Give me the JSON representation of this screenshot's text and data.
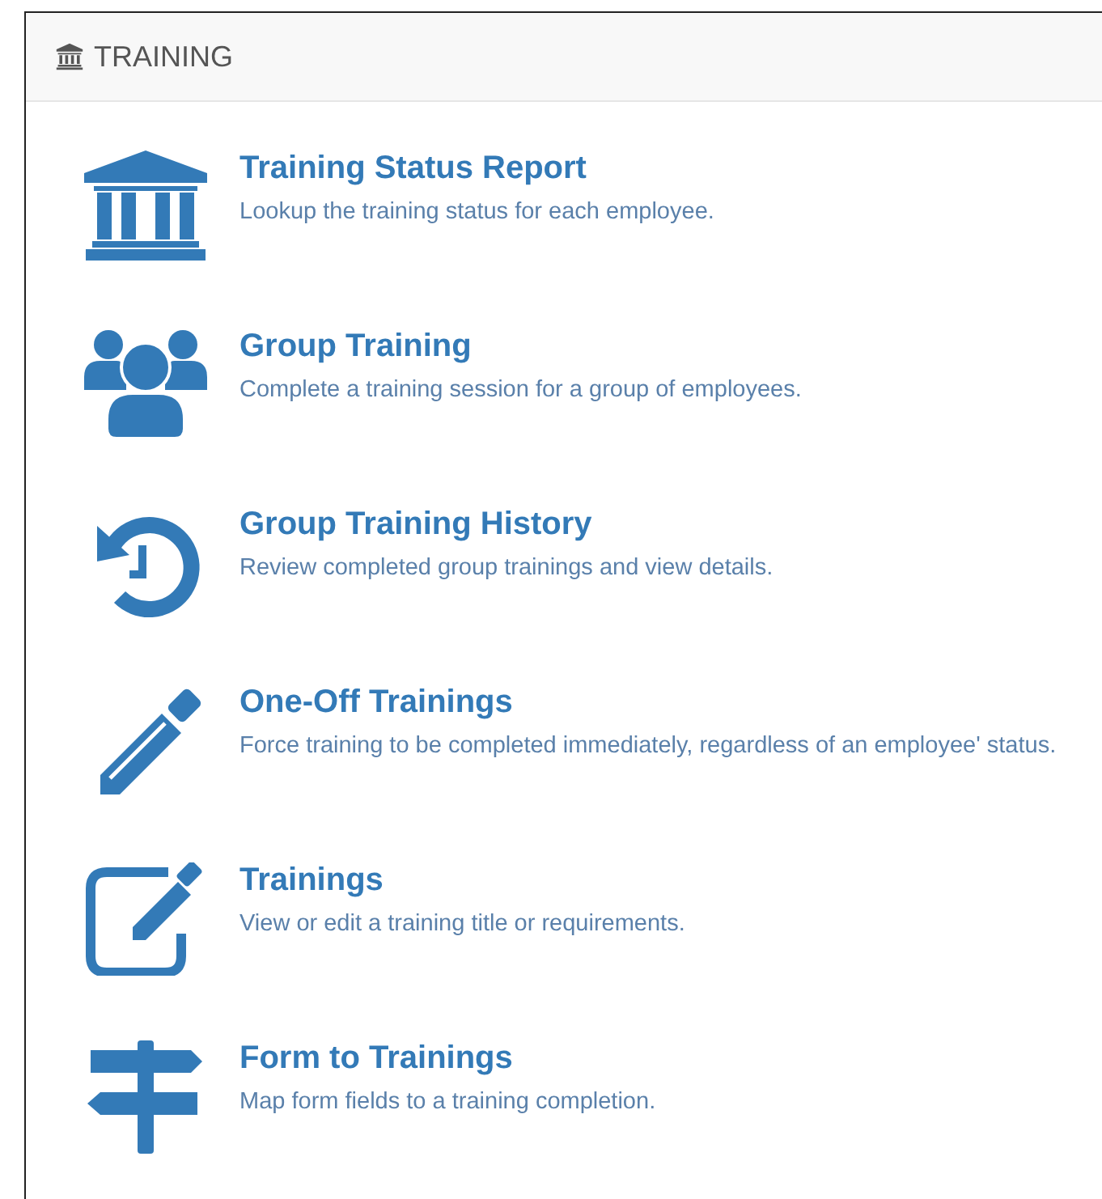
{
  "panel": {
    "title": "TRAINING"
  },
  "items": [
    {
      "kind": "bank",
      "title": "Training Status Report",
      "description": "Lookup the training status for each employee."
    },
    {
      "kind": "group",
      "title": "Group Training",
      "description": "Complete a training session for a group of employees."
    },
    {
      "kind": "history",
      "title": "Group Training History",
      "description": "Review completed group trainings and view details."
    },
    {
      "kind": "pencil",
      "title": "One-Off Trainings",
      "description": "Force training to be completed immediately, regardless of an employee' status."
    },
    {
      "kind": "edit",
      "title": "Trainings",
      "description": "View or edit a training title or requirements."
    },
    {
      "kind": "signpost",
      "title": "Form to Trainings",
      "description": "Map form fields to a training completion."
    }
  ]
}
